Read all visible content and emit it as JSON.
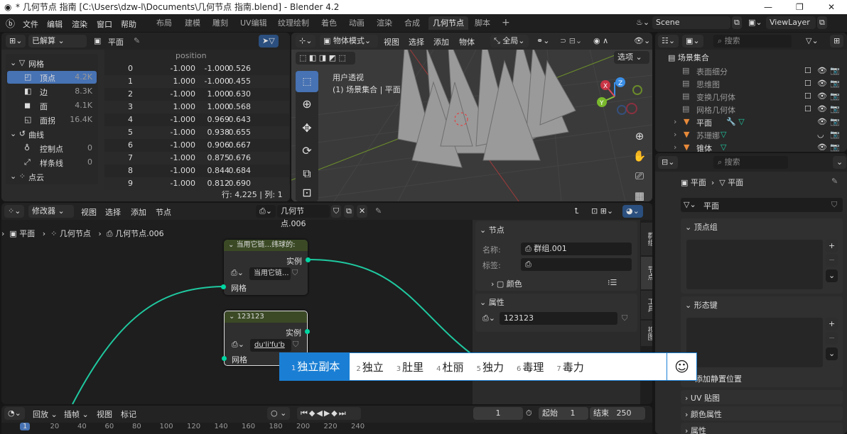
{
  "title": "* 几何节点 指南 [C:\\Users\\dzw-l\\Documents\\几何节点 指南.blend] - Blender 4.2",
  "menu": [
    "文件",
    "编辑",
    "渲染",
    "窗口",
    "帮助"
  ],
  "workspaces": [
    "布局",
    "建模",
    "雕刻",
    "UV编辑",
    "纹理绘制",
    "着色",
    "动画",
    "渲染",
    "合成",
    "几何节点",
    "脚本"
  ],
  "active_workspace": "几何节点",
  "scene": "Scene",
  "view_layer": "ViewLayer",
  "spreadsheet": {
    "mode": "已解算",
    "object": "平面",
    "column": "position",
    "tree": [
      {
        "label": "网格",
        "count": "",
        "level": 0
      },
      {
        "label": "顶点",
        "count": "4.2K",
        "level": 1,
        "selected": true
      },
      {
        "label": "边",
        "count": "8.3K",
        "level": 1
      },
      {
        "label": "面",
        "count": "4.1K",
        "level": 1
      },
      {
        "label": "面拐",
        "count": "16.4K",
        "level": 1
      },
      {
        "label": "曲线",
        "count": "",
        "level": 0
      },
      {
        "label": "控制点",
        "count": "0",
        "level": 1
      },
      {
        "label": "样条线",
        "count": "0",
        "level": 1
      },
      {
        "label": "点云",
        "count": "",
        "level": 0
      }
    ],
    "rows": [
      [
        "0",
        "-1.000",
        "-1.000",
        "0.526"
      ],
      [
        "1",
        "1.000",
        "-1.000",
        "0.455"
      ],
      [
        "2",
        "-1.000",
        "1.000",
        "0.630"
      ],
      [
        "3",
        "1.000",
        "1.000",
        "0.568"
      ],
      [
        "4",
        "-1.000",
        "0.969",
        "0.643"
      ],
      [
        "5",
        "-1.000",
        "0.938",
        "0.655"
      ],
      [
        "6",
        "-1.000",
        "0.906",
        "0.667"
      ],
      [
        "7",
        "-1.000",
        "0.875",
        "0.676"
      ],
      [
        "8",
        "-1.000",
        "0.844",
        "0.684"
      ],
      [
        "9",
        "-1.000",
        "0.812",
        "0.690"
      ]
    ],
    "status": "行: 4,225  |  列: 1"
  },
  "viewport": {
    "mode": "物体模式",
    "menus": [
      "视图",
      "选择",
      "添加",
      "物体"
    ],
    "transform": "全局",
    "options": "选项",
    "view_name": "用户透视",
    "collection": "(1) 场景集合 | 平面"
  },
  "outliner": {
    "search": "搜索",
    "root": "场景集合",
    "items": [
      {
        "label": "表面细分",
        "type": "collection"
      },
      {
        "label": "思维图",
        "type": "collection"
      },
      {
        "label": "变换几何体",
        "type": "collection"
      },
      {
        "label": "网格几何体",
        "type": "collection"
      },
      {
        "label": "平面",
        "type": "object"
      },
      {
        "label": "苏珊娜",
        "type": "object"
      },
      {
        "label": "锥体",
        "type": "object"
      }
    ]
  },
  "properties": {
    "search": "搜索",
    "breadcrumb_obj": "平面",
    "breadcrumb_data": "平面",
    "data_name": "平面",
    "panels": {
      "vertex_groups": "顶点组",
      "shape_keys": "形态键",
      "add_rest": "添加静置位置",
      "uv": "UV 贴图",
      "color_attr": "颜色属性",
      "attributes": "属性"
    }
  },
  "node_editor": {
    "type": "修改器",
    "menus": [
      "视图",
      "选择",
      "添加",
      "节点"
    ],
    "tree_name": "几何节点.006",
    "breadcrumb": [
      "平面",
      "几何节点",
      "几何节点.006"
    ],
    "node1": {
      "title": "当用它链...纬球的:",
      "out": "实例",
      "field": "当用它链...",
      "in": "网格"
    },
    "node2": {
      "title": "123123",
      "out": "实例",
      "field": "du'li'fu'b",
      "in": "网格"
    },
    "sidebar": {
      "node_panel": "节点",
      "name_label": "名称:",
      "name_value": "群组.001",
      "label_label": "标签:",
      "color": "颜色",
      "props_panel": "属性",
      "group_value": "123123",
      "tabs": [
        "群组",
        "节点",
        "工具",
        "视图"
      ]
    }
  },
  "ime": {
    "candidates": [
      {
        "n": "1",
        "t": "独立副本"
      },
      {
        "n": "2",
        "t": "独立"
      },
      {
        "n": "3",
        "t": "肚里"
      },
      {
        "n": "4",
        "t": "杜丽"
      },
      {
        "n": "5",
        "t": "独力"
      },
      {
        "n": "6",
        "t": "毒理"
      },
      {
        "n": "7",
        "t": "毒力"
      }
    ],
    "emoji": "☺"
  },
  "timeline": {
    "menus": [
      "回放",
      "插帧",
      "视图",
      "标记"
    ],
    "current": "1",
    "start_label": "起始",
    "start": "1",
    "end_label": "结束",
    "end": "250",
    "ticks": [
      "1",
      "20",
      "40",
      "60",
      "80",
      "100",
      "120",
      "140",
      "160",
      "180",
      "200",
      "220",
      "240"
    ]
  }
}
